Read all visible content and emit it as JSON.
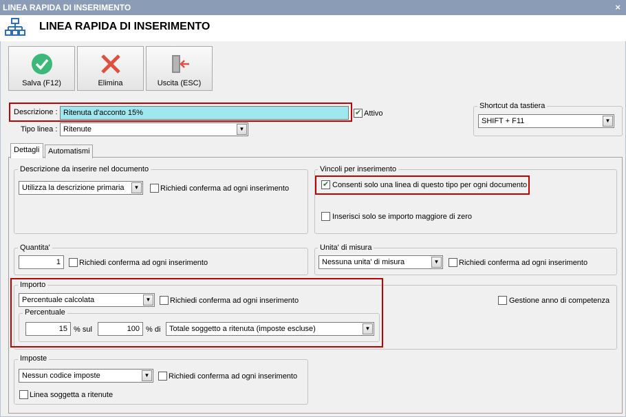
{
  "window": {
    "title": "LINEA RAPIDA DI INSERIMENTO",
    "close_glyph": "×"
  },
  "header": {
    "title": "LINEA RAPIDA DI INSERIMENTO",
    "icon": "sitemap-icon"
  },
  "toolbar": {
    "save_label": "Salva (F12)",
    "delete_label": "Elimina",
    "exit_label": "Uscita (ESC)"
  },
  "form": {
    "descrizione_label": "Descrizione :",
    "descrizione_value": "Ritenuta d'acconto 15%",
    "attivo_label": "Attivo",
    "attivo_checked": true,
    "tipo_linea_label": "Tipo linea :",
    "tipo_linea_value": "Ritenute"
  },
  "shortcut": {
    "title": "Shortcut da tastiera",
    "value": "SHIFT + F11"
  },
  "tabs": [
    {
      "label": "Dettagli",
      "active": true
    },
    {
      "label": "Automatismi",
      "active": false
    }
  ],
  "descrizione_group": {
    "title": "Descrizione da inserire nel documento",
    "select_value": "Utilizza la descrizione primaria",
    "confirm_label": "Richiedi conferma ad ogni inserimento"
  },
  "vincoli_group": {
    "title": "Vincoli per inserimento",
    "consenti_label": "Consenti solo una linea di questo tipo per ogni documento",
    "consenti_checked": true,
    "inserisci_label": "Inserisci solo se importo maggiore di zero",
    "inserisci_checked": false
  },
  "quantita_group": {
    "title": "Quantita'",
    "value": "1",
    "confirm_label": "Richiedi conferma ad ogni inserimento"
  },
  "unita_group": {
    "title": "Unita' di misura",
    "select_value": "Nessuna unita' di misura",
    "confirm_label": "Richiedi conferma ad ogni inserimento"
  },
  "importo_group": {
    "title": "Importo",
    "select_value": "Percentuale calcolata",
    "confirm_label": "Richiedi conferma ad ogni inserimento",
    "gestione_label": "Gestione anno di competenza",
    "percentuale": {
      "title": "Percentuale",
      "percent_value": "15",
      "percent_sul_label": "% sul",
      "base_value": "100",
      "percent_di_label": "% di",
      "select_value": "Totale soggetto a ritenuta (imposte escluse)"
    }
  },
  "imposte_group": {
    "title": "Imposte",
    "select_value": "Nessun codice imposte",
    "confirm_label": "Richiedi conferma ad ogni inserimento",
    "linea_label": "Linea soggetta a ritenute"
  },
  "colors": {
    "accent_red": "#c00000",
    "highlight_input": "#a0e8f0",
    "title_bar": "#8a9cb6"
  }
}
